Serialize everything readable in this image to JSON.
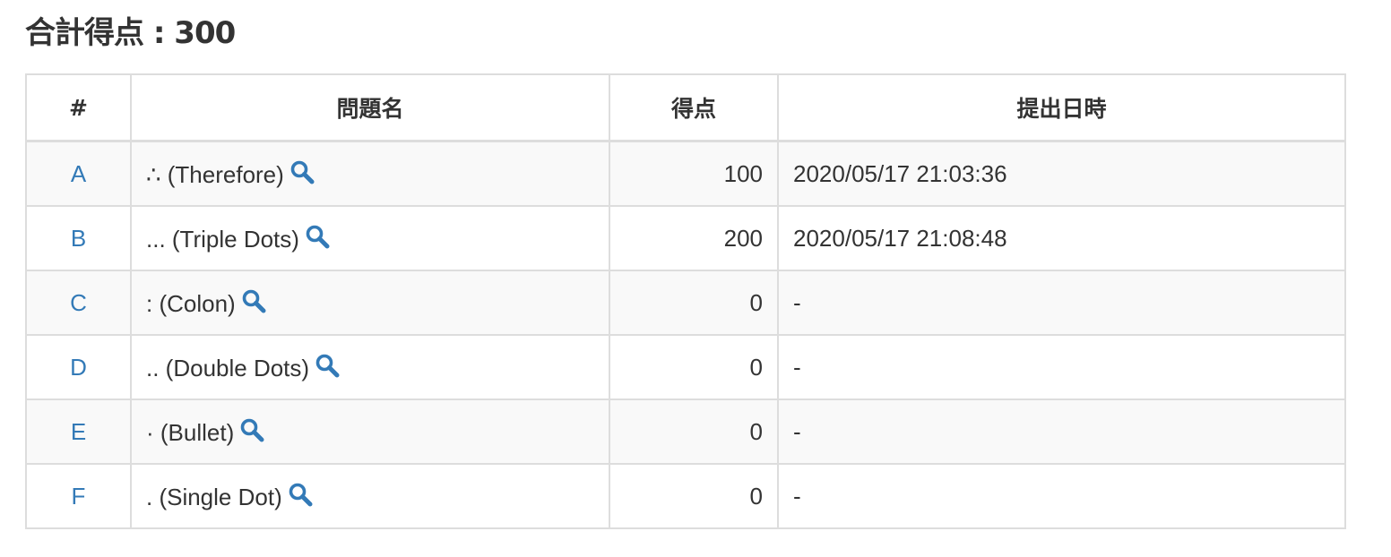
{
  "summary": {
    "label": "合計得点",
    "separator": " : ",
    "value": "300"
  },
  "table": {
    "headers": {
      "id": "#",
      "name": "問題名",
      "score": "得点",
      "submitted": "提出日時"
    },
    "rows": [
      {
        "id": "A",
        "name": "∴ (Therefore)",
        "score": "100",
        "submitted": "2020/05/17 21:03:36",
        "icon": "search-icon"
      },
      {
        "id": "B",
        "name": "... (Triple Dots)",
        "score": "200",
        "submitted": "2020/05/17 21:08:48",
        "icon": "search-icon"
      },
      {
        "id": "C",
        "name": ": (Colon)",
        "score": "0",
        "submitted": "-",
        "icon": "search-icon"
      },
      {
        "id": "D",
        "name": ".. (Double Dots)",
        "score": "0",
        "submitted": "-",
        "icon": "search-icon"
      },
      {
        "id": "E",
        "name": "· (Bullet)",
        "score": "0",
        "submitted": "-",
        "icon": "search-icon"
      },
      {
        "id": "F",
        "name": ". (Single Dot)",
        "score": "0",
        "submitted": "-",
        "icon": "search-icon"
      }
    ]
  },
  "colors": {
    "link": "#337ab7",
    "text": "#333333",
    "border": "#dddddd",
    "stripe": "#f9f9f9"
  }
}
